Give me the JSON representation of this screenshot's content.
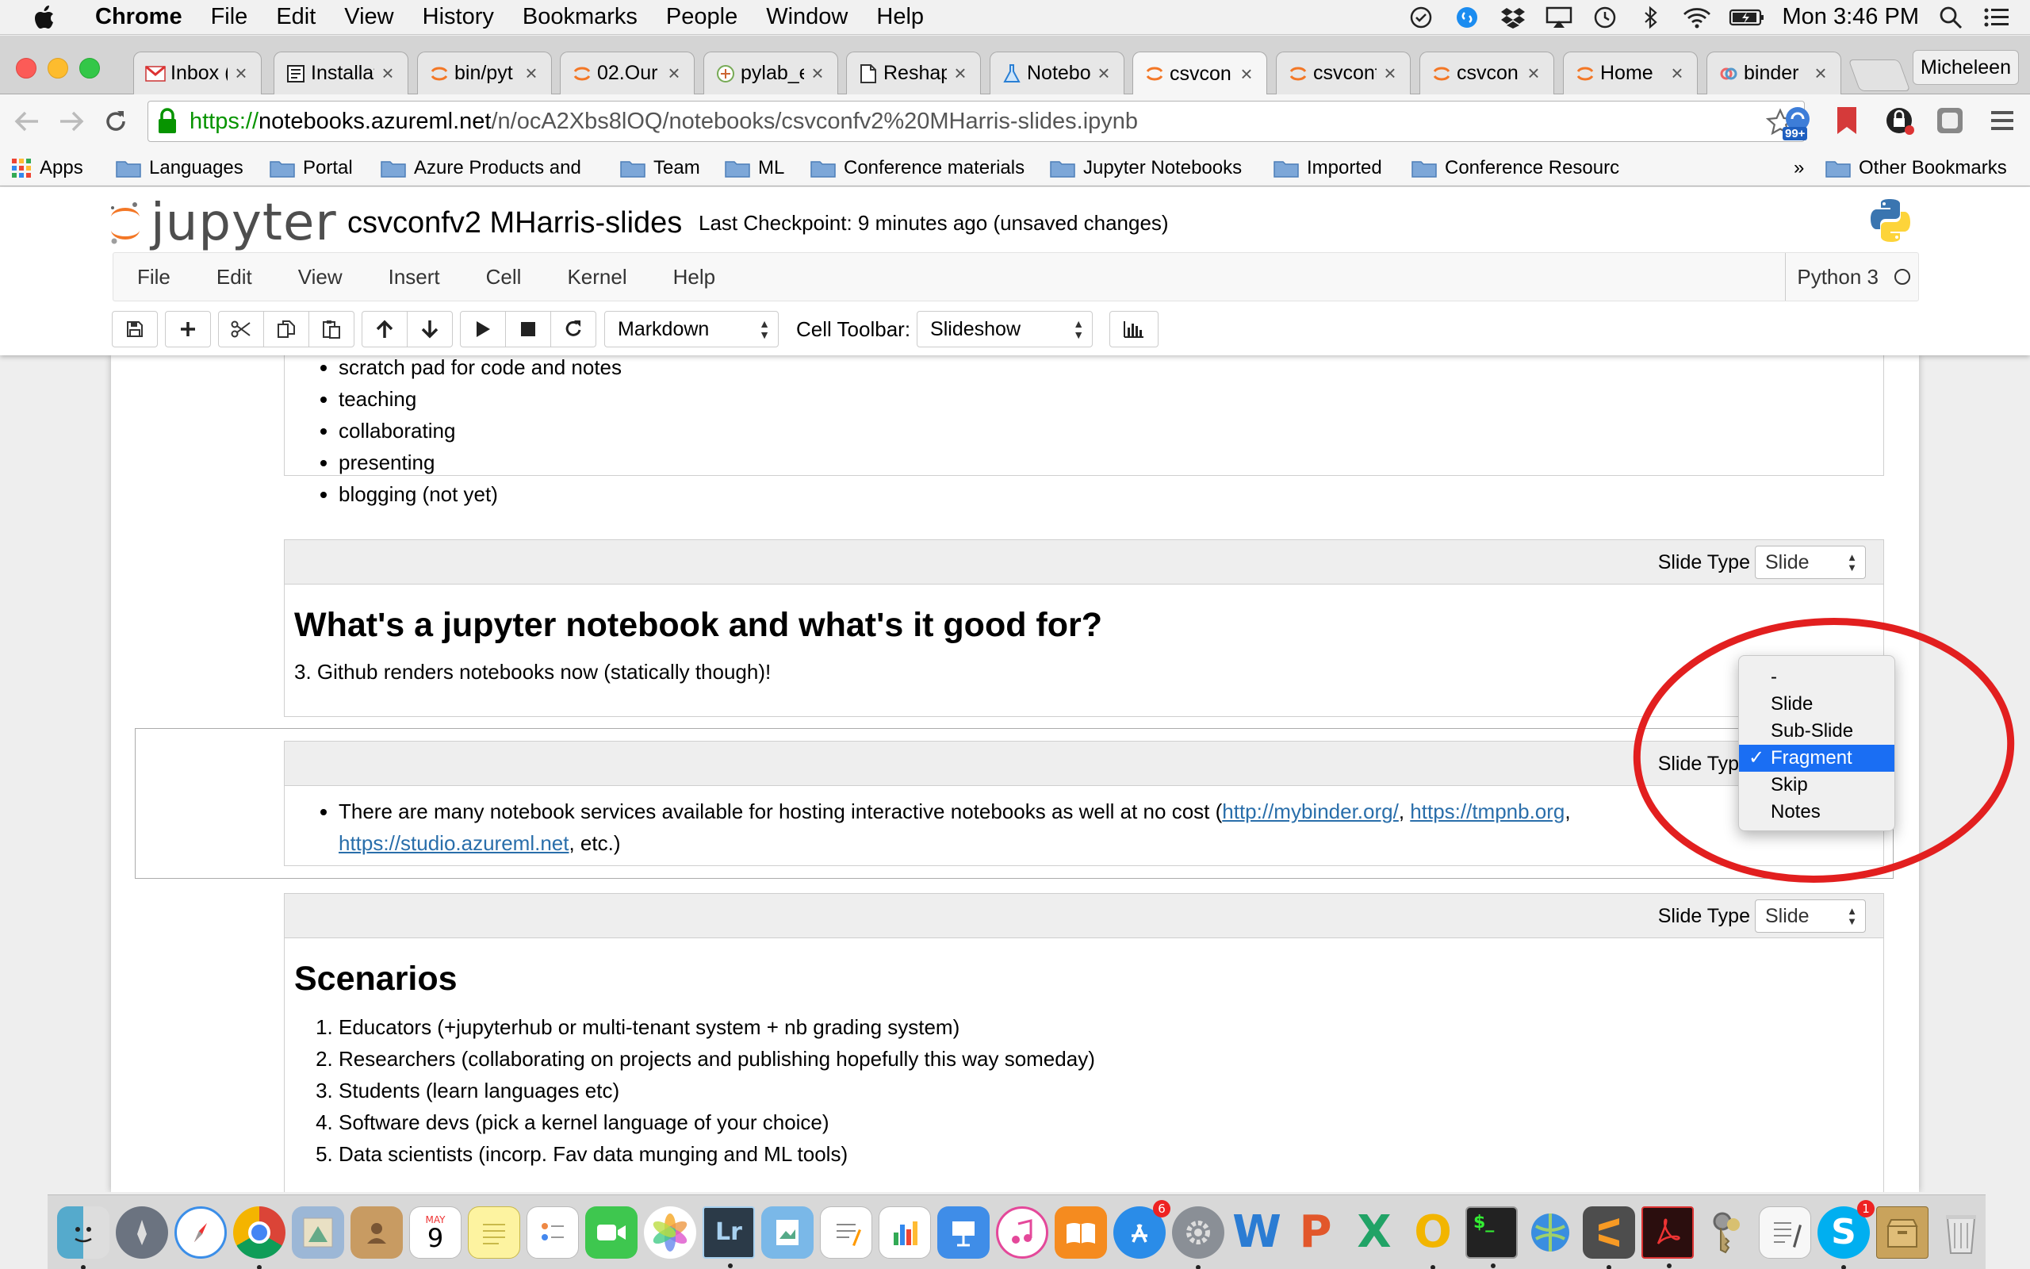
{
  "menubar": {
    "app": "Chrome",
    "items": [
      "File",
      "Edit",
      "View",
      "History",
      "Bookmarks",
      "People",
      "Window",
      "Help"
    ],
    "clock": "Mon 3:46 PM"
  },
  "tabs": [
    {
      "label": "Inbox (",
      "icon": "gmail-icon"
    },
    {
      "label": "Installat",
      "icon": "page-icon"
    },
    {
      "label": "bin/pyt",
      "icon": "jupyter-icon"
    },
    {
      "label": "02.Our",
      "icon": "jupyter-icon"
    },
    {
      "label": "pylab_e",
      "icon": "pylab-icon"
    },
    {
      "label": "Reshap",
      "icon": "document-icon"
    },
    {
      "label": "Notebo",
      "icon": "flask-icon"
    },
    {
      "label": "csvcon",
      "icon": "jupyter-icon",
      "active": true
    },
    {
      "label": "csvconf",
      "icon": "jupyter-icon"
    },
    {
      "label": "csvcon",
      "icon": "jupyter-icon"
    },
    {
      "label": "Home",
      "icon": "jupyter-icon"
    },
    {
      "label": "binder",
      "icon": "binder-icon"
    }
  ],
  "profile": "Micheleen",
  "url": {
    "scheme": "https://",
    "host": "notebooks.azureml.net",
    "path": "/n/ocA2Xbs8lOQ/notebooks/csvconfv2%20MHarris-slides.ipynb"
  },
  "extension_badge": "99+",
  "bookmarks": [
    "Apps",
    "Languages",
    "Portal",
    "Azure Products and",
    "Team",
    "ML",
    "Conference materials",
    "Jupyter Notebooks",
    "Imported",
    "Conference Resourc",
    "»",
    "Other Bookmarks"
  ],
  "jupyter": {
    "logo_text": "jupyter",
    "notebook_name": "csvconfv2 MHarris-slides",
    "checkpoint": "Last Checkpoint: 9 minutes ago (unsaved changes)",
    "menu": [
      "File",
      "Edit",
      "View",
      "Insert",
      "Cell",
      "Kernel",
      "Help"
    ],
    "kernel": "Python 3",
    "cell_type": "Markdown",
    "cell_toolbar_label": "Cell Toolbar:",
    "cell_toolbar_value": "Slideshow"
  },
  "cells": {
    "c1_items": [
      "scratch pad for code and notes",
      "teaching",
      "collaborating",
      "presenting",
      "blogging (not yet)"
    ],
    "c2": {
      "slide_type_label": "Slide Type",
      "slide_type": "Slide",
      "heading": "What's a jupyter notebook and what's it good for?",
      "text": "3. Github renders notebooks now (statically though)!"
    },
    "c3": {
      "slide_type_label": "Slide Type",
      "text_before": "There are many notebook services available for hosting interactive notebooks as well at no cost (",
      "link1": "http://mybinder.org/",
      "sep1": ", ",
      "link2": "https://tmpnb.org",
      "sep2": ",",
      "link3": "https://studio.azureml.net",
      "text_after": ", etc.)"
    },
    "c4": {
      "slide_type_label": "Slide Type",
      "slide_type": "Slide",
      "heading": "Scenarios",
      "items": [
        "Educators (+jupyterhub or multi-tenant system + nb grading system)",
        "Researchers (collaborating on projects and publishing hopefully this way someday)",
        "Students (learn languages etc)",
        "Software devs (pick a kernel language of your choice)",
        "Data scientists (incorp. Fav data munging and ML tools)"
      ]
    }
  },
  "dropdown": {
    "options": [
      "-",
      "Slide",
      "Sub-Slide",
      "Fragment",
      "Skip",
      "Notes"
    ],
    "selected": "Fragment",
    "check": "✓"
  },
  "dock": {
    "calendar_month": "MAY",
    "calendar_day": "9",
    "appstore_badge": "6",
    "skype_badge": "1",
    "lightroom": "Lr"
  },
  "colors": {
    "jupyter_orange": "#f37726",
    "selection_blue": "#1a6ef3",
    "annotation_red": "#e21f1f",
    "link": "#296eaa"
  }
}
